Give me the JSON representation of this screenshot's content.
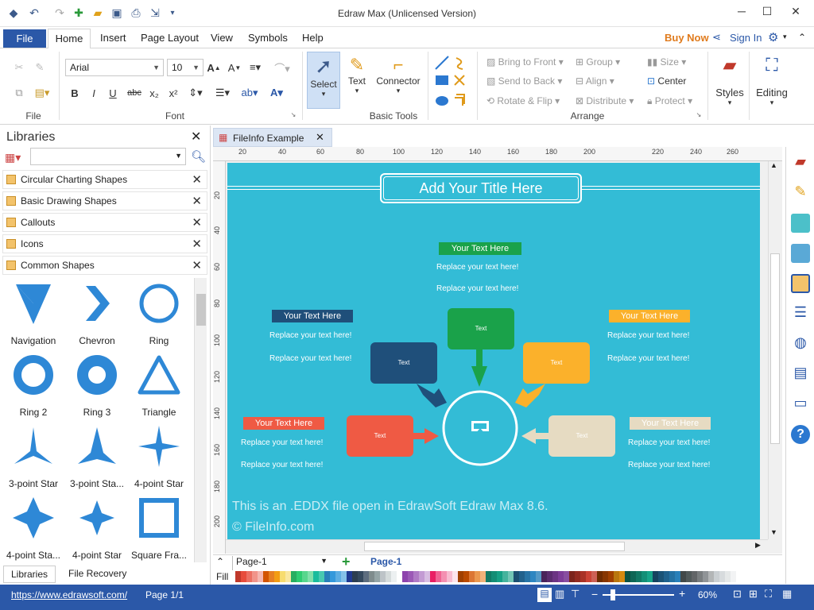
{
  "app": {
    "title": "Edraw Max (Unlicensed Version)"
  },
  "menubar": {
    "file": "File",
    "tabs": [
      "Home",
      "Insert",
      "Page Layout",
      "View",
      "Symbols",
      "Help"
    ],
    "buy_now": "Buy Now",
    "sign_in": "Sign In"
  },
  "ribbon": {
    "font_name": "Arial",
    "font_size": "10",
    "groups": {
      "file": "File",
      "font": "Font",
      "basic_tools": "Basic Tools",
      "arrange": "Arrange"
    },
    "tools": {
      "select": "Select",
      "text": "Text",
      "connector": "Connector"
    },
    "arrange": {
      "bring_to_front": "Bring to Front",
      "send_to_back": "Send to Back",
      "rotate_flip": "Rotate & Flip",
      "group": "Group",
      "align": "Align",
      "distribute": "Distribute",
      "size": "Size",
      "center": "Center",
      "protect": "Protect"
    },
    "styles": "Styles",
    "editing": "Editing"
  },
  "libraries": {
    "title": "Libraries",
    "categories": [
      "Circular Charting Shapes",
      "Basic Drawing Shapes",
      "Callouts",
      "Icons",
      "Common Shapes"
    ],
    "shapes": [
      "Navigation",
      "Chevron",
      "Ring",
      "Ring 2",
      "Ring 3",
      "Triangle",
      "3-point Star",
      "3-point Sta...",
      "4-point Star",
      "4-point Sta...",
      "4-point Star",
      "Square Fra..."
    ],
    "bottom_tabs": [
      "Libraries",
      "File Recovery"
    ]
  },
  "document": {
    "tab_title": "FileInfo Example",
    "ruler_top": [
      "20",
      "40",
      "60",
      "80",
      "100",
      "120",
      "140",
      "160",
      "180",
      "200",
      "220",
      "240",
      "260"
    ],
    "ruler_left": [
      "20",
      "40",
      "60",
      "80",
      "100",
      "120",
      "140",
      "160",
      "180",
      "200"
    ]
  },
  "diagram": {
    "title": "Add Your Title Here",
    "tag": "Your Text Here",
    "replace": "Replace your text here!",
    "callout": "Text",
    "colors": {
      "green": "#1aa24a",
      "navy": "#1f4f7a",
      "orange": "#fbb12b",
      "red": "#ef5a44",
      "beige": "#e6dbc2"
    },
    "watermark_1": "This is an .EDDX file open in EdrawSoft Edraw Max 8.6.",
    "watermark_2": "© FileInfo.com"
  },
  "pagebar": {
    "page_dropdown": "Page-1",
    "active_page": "Page-1",
    "fill_label": "Fill"
  },
  "status": {
    "url": "https://www.edrawsoft.com/",
    "page": "Page 1/1",
    "zoom": "60%"
  }
}
